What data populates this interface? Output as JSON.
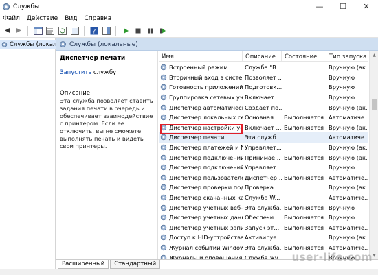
{
  "window": {
    "title": "Службы"
  },
  "menu": [
    "Файл",
    "Действие",
    "Вид",
    "Справка"
  ],
  "tree": {
    "item": "Службы (локалы"
  },
  "header": {
    "title": "Службы (локальные)"
  },
  "details": {
    "title": "Диспетчер печати",
    "link": "Запустить",
    "link_suffix": " службу",
    "desc_head": "Описание:",
    "desc_text": "Эта служба позволяет ставить задания печати в очередь и обеспечивает взаимодействие с принтером. Если ее отключить, вы не сможете выполнять печать и видеть свои принтеры."
  },
  "columns": {
    "name": "Имя",
    "desc": "Описание",
    "state": "Состояние",
    "start": "Тип запуска"
  },
  "rows": [
    {
      "name": "Встроенный режим",
      "desc": "Служба \"В...",
      "state": "",
      "start": "Вручную (ак..."
    },
    {
      "name": "Вторичный вход в систему",
      "desc": "Позволяет ...",
      "state": "",
      "start": "Вручную"
    },
    {
      "name": "Готовность приложений",
      "desc": "Подготовк...",
      "state": "",
      "start": "Вручную"
    },
    {
      "name": "Группировка сетевых учас...",
      "desc": "Включает ...",
      "state": "",
      "start": "Вручную"
    },
    {
      "name": "Диспетчер автоматически...",
      "desc": "Создает по...",
      "state": "",
      "start": "Вручную (ак..."
    },
    {
      "name": "Диспетчер локальных сеа...",
      "desc": "Основная ...",
      "state": "Выполняется",
      "start": "Автоматиче..."
    },
    {
      "name": "Диспетчер настройки устр...",
      "desc": "Включает ...",
      "state": "Выполняется",
      "start": "Вручную (ак..."
    },
    {
      "name": "Диспетчер печати",
      "desc": "Эта служб...",
      "state": "",
      "start": "Автоматиче..."
    },
    {
      "name": "Диспетчер платежей и NF...",
      "desc": "Управляет...",
      "state": "",
      "start": "Вручную (ак..."
    },
    {
      "name": "Диспетчер подключений ...",
      "desc": "Принимае...",
      "state": "Выполняется",
      "start": "Вручную (ак..."
    },
    {
      "name": "Диспетчер подключений ...",
      "desc": "Управляет...",
      "state": "",
      "start": "Вручную"
    },
    {
      "name": "Диспетчер пользователей",
      "desc": "Диспетчер ...",
      "state": "Выполняется",
      "start": "Автоматиче..."
    },
    {
      "name": "Диспетчер проверки подл...",
      "desc": "Проверка ...",
      "state": "",
      "start": "Вручную (ак..."
    },
    {
      "name": "Диспетчер скачанных карт",
      "desc": "Служба W...",
      "state": "",
      "start": "Автоматиче..."
    },
    {
      "name": "Диспетчер учетных веб-за...",
      "desc": "Эта служба...",
      "state": "Выполняется",
      "start": "Вручную"
    },
    {
      "name": "Диспетчер учетных данных",
      "desc": "Обеспечи...",
      "state": "Выполняется",
      "start": "Вручную"
    },
    {
      "name": "Диспетчер учетных записе...",
      "desc": "Запуск эт...",
      "state": "Выполняется",
      "start": "Автоматиче..."
    },
    {
      "name": "Доступ к HID-устройствам",
      "desc": "Активирує...",
      "state": "",
      "start": "Вручную (ак..."
    },
    {
      "name": "Журнал событий Windows",
      "desc": "Эта служба...",
      "state": "Выполняется",
      "start": "Автоматиче..."
    },
    {
      "name": "Журналы и оповещения п...",
      "desc": "Служба жу...",
      "state": "",
      "start": "Вручную"
    }
  ],
  "tabs": [
    "Расширенный",
    "Стандартный"
  ],
  "watermark": "user-life.com"
}
